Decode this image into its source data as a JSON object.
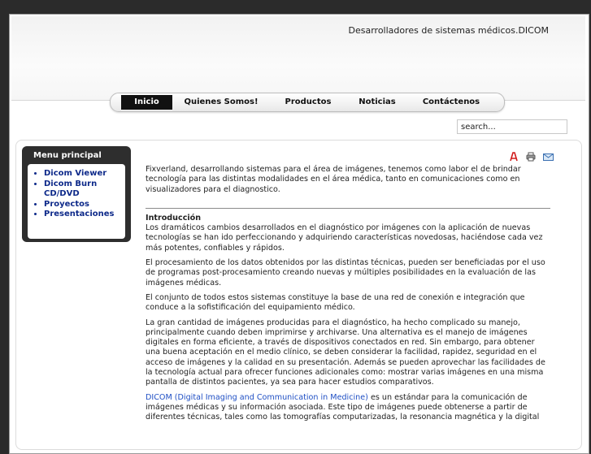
{
  "header": {
    "tagline": "Desarrolladores de sistemas médicos.DICOM"
  },
  "nav": {
    "items": [
      {
        "label": "Inicio"
      },
      {
        "label": "Quienes Somos!"
      },
      {
        "label": "Productos"
      },
      {
        "label": "Noticias"
      },
      {
        "label": "Contáctenos"
      }
    ],
    "active": "Inicio"
  },
  "search": {
    "value": "search..."
  },
  "sidebar": {
    "title": "Menu principal",
    "items": [
      {
        "label": "Dicom Viewer"
      },
      {
        "label": "Dicom Burn CD/DVD"
      },
      {
        "label": "Proyectos"
      },
      {
        "label": "Presentaciones"
      }
    ]
  },
  "article_icons": [
    "pdf-icon",
    "print-icon",
    "email-icon"
  ],
  "article": {
    "intro": "Fixverland, desarrollando sistemas para el área de imágenes, tenemos como labor el de brindar tecnología para las distintas modalidades en el área médica, tanto en comunicaciones como en visualizadores para el diagnostico.",
    "heading": "Introducción",
    "p1": "Los dramáticos cambios desarrollados en el diagnóstico por imágenes con la aplicación de nuevas tecnologías se han ido perfeccionando y adquiriendo características novedosas, haciéndose cada vez más potentes, confiables y rápidos.",
    "p2": "El procesamiento de los datos obtenidos por las distintas técnicas, pueden ser beneficiadas por el uso de programas post-procesamiento creando nuevas y múltiples posibilidades en la evaluación de las imágenes médicas.",
    "p3": "El conjunto de todos estos sistemas constituye la base de una red de conexión e integración que conduce a la sofistificación del equipamiento médico.",
    "p4": "La gran cantidad de imágenes producidas para el diagnóstico, ha hecho complicado su manejo, principalmente cuando deben imprimirse y archivarse. Una alternativa es el manejo de imágenes digitales en forma eficiente, a través de dispositivos conectados en red. Sin embargo, para obtener una buena aceptación en el medio clínico, se deben considerar la facilidad, rapidez, seguridad en el acceso de imágenes y la calidad en su presentación. Además se pueden aprovechar las facilidades de la tecnología actual para ofrecer funciones adicionales como: mostrar varias imágenes en una misma pantalla de distintos pacientes, ya sea para hacer estudios comparativos.",
    "p5_link": "DICOM (Digital Imaging and Communication in Medicine)",
    "p5_text": " es un estándar para la comunicación de imágenes médicas y su información asociada. Este tipo de imágenes puede obtenerse a partir de diferentes técnicas, tales como las tomografías computarizadas, la resonancia magnética y la digital"
  }
}
